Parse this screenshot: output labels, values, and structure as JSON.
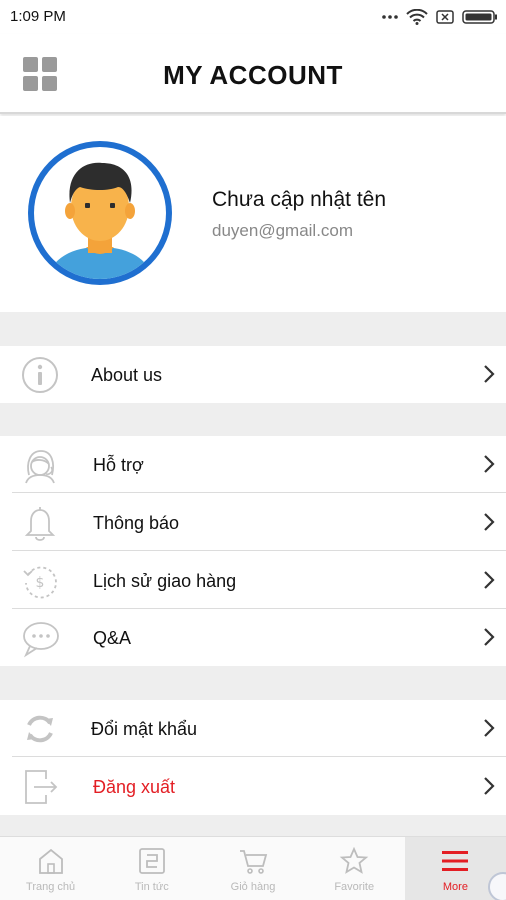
{
  "status_bar": {
    "time": "1:09 PM"
  },
  "header": {
    "title": "MY ACCOUNT"
  },
  "profile": {
    "name": "Chưa cập nhật tên",
    "email": "duyen@gmail.com"
  },
  "menu_groups": [
    [
      {
        "label": "About us",
        "icon": "info-icon"
      }
    ],
    [
      {
        "label": "Hỗ trợ",
        "icon": "support-agent-icon"
      },
      {
        "label": "Thông báo",
        "icon": "bell-icon"
      },
      {
        "label": "Lịch sử giao hàng",
        "icon": "payment-history-icon"
      },
      {
        "label": "Q&A",
        "icon": "chat-bubble-icon"
      }
    ],
    [
      {
        "label": "Đổi mật khẩu",
        "icon": "refresh-icon"
      },
      {
        "label": "Đăng xuất",
        "icon": "logout-icon",
        "color": "#e31e24"
      }
    ]
  ],
  "bottom_nav": [
    {
      "label": "Trang chủ",
      "icon": "home-icon"
    },
    {
      "label": "Tin tức",
      "icon": "news-icon"
    },
    {
      "label": "Giỏ hàng",
      "icon": "cart-icon"
    },
    {
      "label": "Favorite",
      "icon": "star-icon"
    },
    {
      "label": "More",
      "icon": "menu-icon",
      "active": true
    }
  ],
  "colors": {
    "accent": "#e31e24",
    "avatar_ring": "#1f6fd0",
    "icon_gray": "#bdbdbd"
  }
}
